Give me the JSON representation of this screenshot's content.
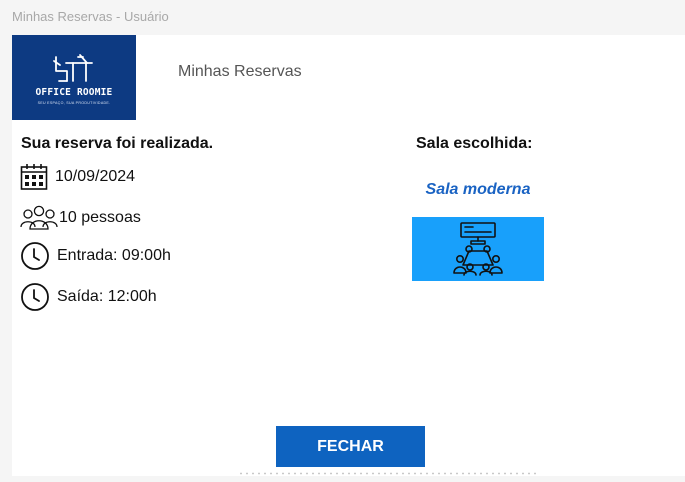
{
  "window": {
    "title": "Minhas Reservas - Usuário"
  },
  "logo": {
    "name": "OFFICE ROOMIE",
    "tagline": "SEU ESPAÇO, SUA PRODUTIVIDADE."
  },
  "header": {
    "title": "Minhas Reservas"
  },
  "reservation": {
    "confirmation": "Sua reserva foi realizada.",
    "date": "10/09/2024",
    "people": "10 pessoas",
    "entry": "Entrada: 09:00h",
    "exit": "Saída: 12:00h"
  },
  "room": {
    "heading": "Sala escolhida:",
    "name": "Sala moderna",
    "icon": "meeting-room-icon",
    "tile_color": "#18a0fb"
  },
  "actions": {
    "close_label": "FECHAR"
  },
  "colors": {
    "logo_bg": "#0d3a82",
    "accent": "#0e63c0",
    "room_name": "#1a63c3"
  },
  "icons": {
    "date": "calendar-icon",
    "people": "people-icon",
    "entry": "clock-icon",
    "exit": "clock-icon"
  }
}
